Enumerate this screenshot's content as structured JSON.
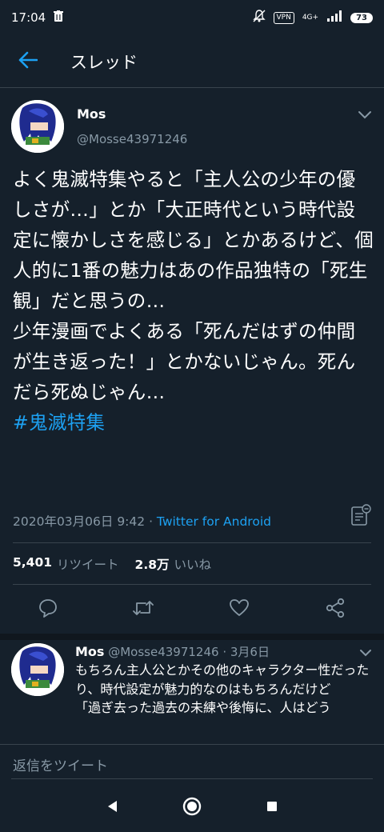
{
  "status_bar": {
    "time": "17:04",
    "vpn": "VPN",
    "network": "4G+",
    "battery": "73"
  },
  "app_bar": {
    "title": "スレッド"
  },
  "tweet": {
    "author_name": "Mos",
    "author_handle": "@Mosse43971246",
    "body_lines": [
      "よく鬼滅特集やると「主人公の少年の優しさが…」とか「大正時代という時代設定に懐かしさを感じる」とかあるけど、個人的に1番の魅力はあの作品独特の「死生観」だと思うの…",
      "少年漫画でよくある「死んだはずの仲間が生き返った！」とかないじゃん。死んだら死ぬじゃん…"
    ],
    "hashtag": "#鬼滅特集",
    "timestamp": "2020年03月06日 9:42",
    "separator": " · ",
    "source": "Twitter for Android",
    "retweet_count": "5,401",
    "retweet_label": "リツイート",
    "like_count": "2.8万",
    "like_label": "いいね"
  },
  "reply": {
    "author_name": "Mos",
    "author_handle": "@Mosse43971246",
    "separator": " · ",
    "date": "3月6日",
    "text_lines": [
      "もちろん主人公とかその他のキャラクター性だったり、時代設定が魅力的なのはもちろんだけど",
      "「過ぎ去った過去の未練や後悔に、人はどう"
    ]
  },
  "reply_input": {
    "placeholder": "返信をツイート"
  },
  "colors": {
    "background": "#15202b",
    "accent": "#1da1f2",
    "secondary_text": "#8899a6",
    "divider": "#38444d"
  },
  "icons": {
    "back": "arrow-left-icon",
    "caret": "chevron-down-icon",
    "analytics": "analytics-icon",
    "reply": "comment-icon",
    "retweet": "retweet-icon",
    "like": "heart-icon",
    "share": "share-icon"
  }
}
